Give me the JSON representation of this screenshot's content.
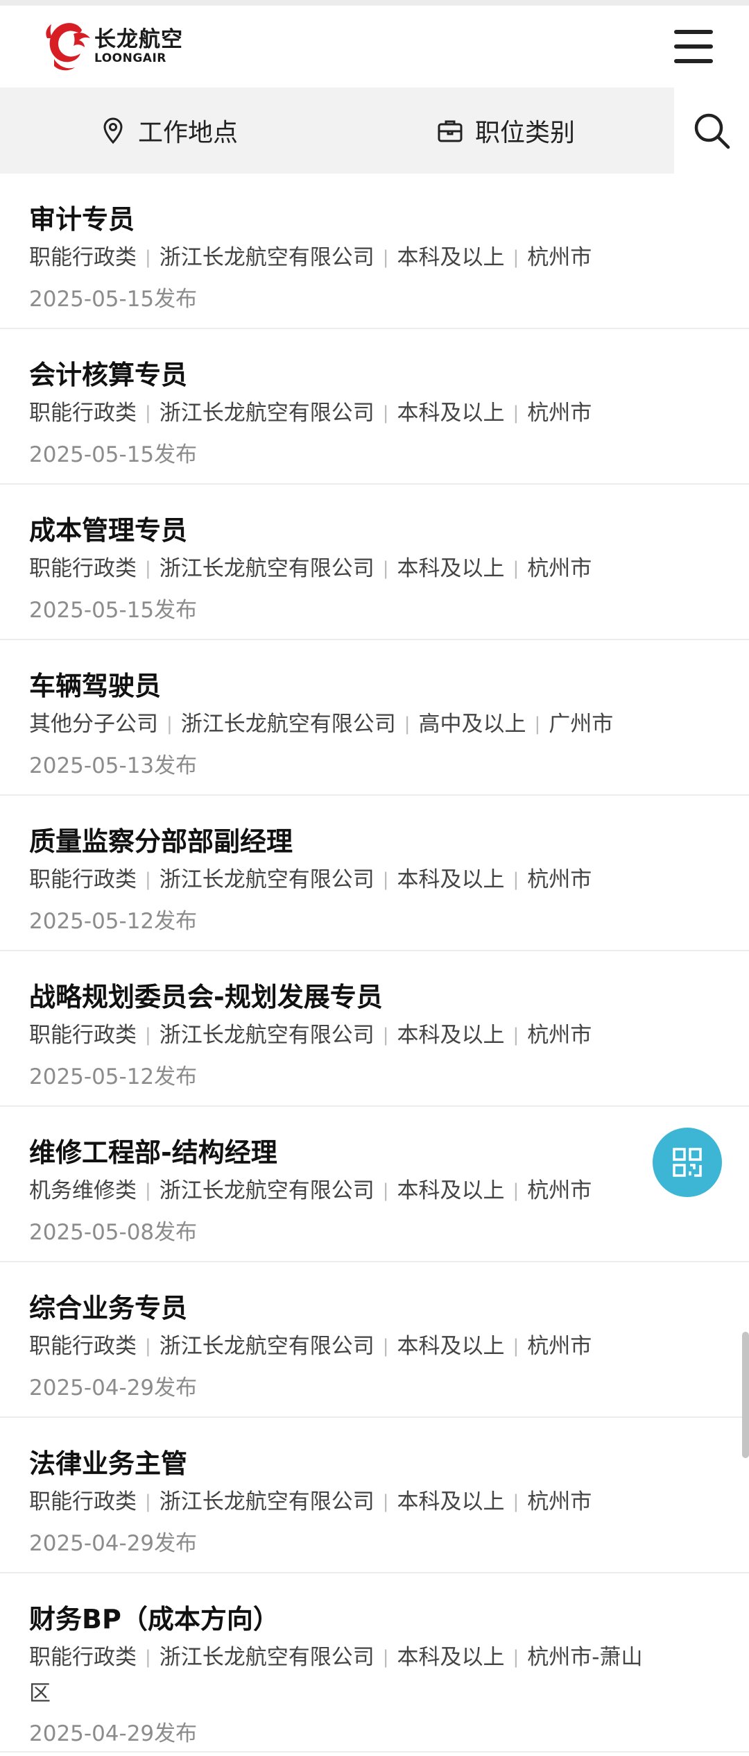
{
  "brand": {
    "name_cn": "长龙航空",
    "name_en": "LOONGAIR",
    "color": "#d81e25"
  },
  "header": {
    "menu_icon": "hamburger-menu-icon"
  },
  "filters": {
    "location_label": "工作地点",
    "location_icon": "map-pin-icon",
    "category_label": "职位类别",
    "category_icon": "briefcase-icon",
    "search_icon": "search-icon"
  },
  "jobs": [
    {
      "title": "审计专员",
      "category": "职能行政类",
      "company": "浙江长龙航空有限公司",
      "education": "本科及以上",
      "city": "杭州市",
      "date": "2025-05-15发布"
    },
    {
      "title": "会计核算专员",
      "category": "职能行政类",
      "company": "浙江长龙航空有限公司",
      "education": "本科及以上",
      "city": "杭州市",
      "date": "2025-05-15发布"
    },
    {
      "title": "成本管理专员",
      "category": "职能行政类",
      "company": "浙江长龙航空有限公司",
      "education": "本科及以上",
      "city": "杭州市",
      "date": "2025-05-15发布"
    },
    {
      "title": "车辆驾驶员",
      "category": "其他分子公司",
      "company": "浙江长龙航空有限公司",
      "education": "高中及以上",
      "city": "广州市",
      "date": "2025-05-13发布"
    },
    {
      "title": "质量监察分部部副经理",
      "category": "职能行政类",
      "company": "浙江长龙航空有限公司",
      "education": "本科及以上",
      "city": "杭州市",
      "date": "2025-05-12发布"
    },
    {
      "title": "战略规划委员会-规划发展专员",
      "category": "职能行政类",
      "company": "浙江长龙航空有限公司",
      "education": "本科及以上",
      "city": "杭州市",
      "date": "2025-05-12发布"
    },
    {
      "title": "维修工程部-结构经理",
      "category": "机务维修类",
      "company": "浙江长龙航空有限公司",
      "education": "本科及以上",
      "city": "杭州市",
      "date": "2025-05-08发布"
    },
    {
      "title": "综合业务专员",
      "category": "职能行政类",
      "company": "浙江长龙航空有限公司",
      "education": "本科及以上",
      "city": "杭州市",
      "date": "2025-04-29发布"
    },
    {
      "title": "法律业务主管",
      "category": "职能行政类",
      "company": "浙江长龙航空有限公司",
      "education": "本科及以上",
      "city": "杭州市",
      "date": "2025-04-29发布"
    },
    {
      "title": "财务BP（成本方向）",
      "category": "职能行政类",
      "company": "浙江长龙航空有限公司",
      "education": "本科及以上",
      "city": "杭州市-萧山区",
      "date": "2025-04-29发布"
    }
  ],
  "floating": {
    "qr_icon": "qr-code-icon",
    "color": "#3db6d6"
  }
}
